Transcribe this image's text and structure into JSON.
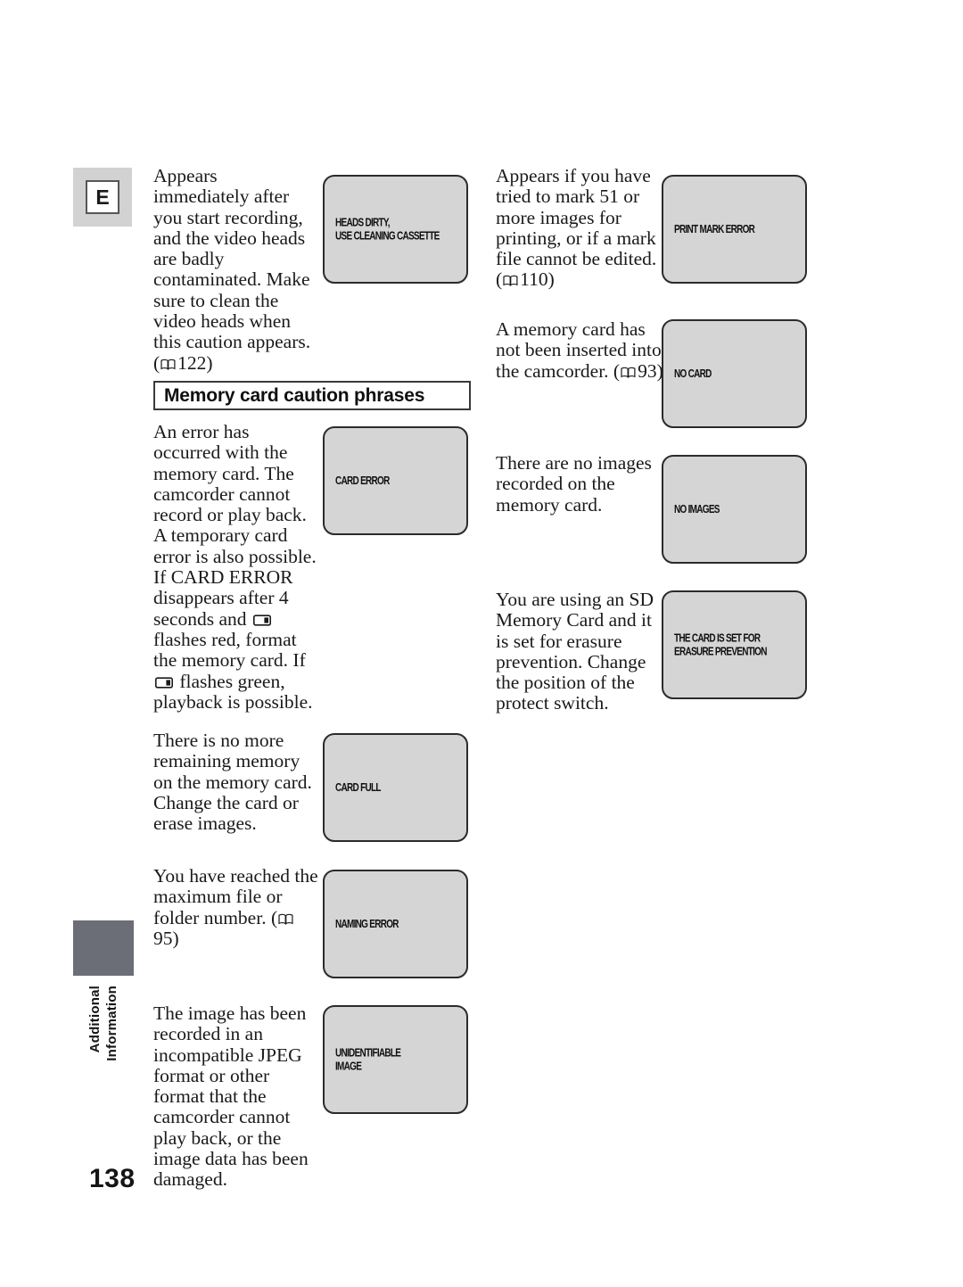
{
  "page": {
    "number": "138",
    "language_badge": "E",
    "side_tab_line1": "Additional",
    "side_tab_line2": "Information",
    "accent_gray": "#6b6e77",
    "lcd_fill": "#d5d5d5"
  },
  "section_heading": "Memory card caution phrases",
  "left_column": [
    {
      "description_pre": "Appears immediately after you start recording, and the video heads are badly contaminated. Make sure to clean the video heads when this caution appears. (",
      "page_ref": "122",
      "description_post": ")",
      "lcd_text": "HEADS DIRTY,\nUSE CLEANING CASSETTE"
    },
    {
      "description_pre": "An error has occurred with the memory card. The camcorder cannot record or play back. A temporary card error is also possible. If CARD ERROR disappears after 4 seconds and ",
      "description_mid": " flashes red, format the memory card. If ",
      "description_post": " flashes green, playback is possible.",
      "lcd_text": "CARD ERROR"
    },
    {
      "description_pre": "There is no more remaining memory on the memory card. Change the card or erase images.",
      "lcd_text": "CARD FULL"
    },
    {
      "description_pre": "You have reached the maximum file or folder number. (",
      "page_ref": "95",
      "description_post": ")",
      "lcd_text": "NAMING ERROR"
    },
    {
      "description_pre": "The image has been recorded in an incompatible JPEG format or other format that the camcorder cannot play back, or the image data has been damaged.",
      "lcd_text": "UNIDENTIFIABLE\n IMAGE"
    }
  ],
  "right_column": [
    {
      "description_pre": "Appears if you have tried to mark 51 or more images for printing, or if a mark file cannot be edited. (",
      "page_ref": "110",
      "description_post": ")",
      "lcd_text": "PRINT MARK ERROR"
    },
    {
      "description_pre": "A memory card has not been inserted into the camcorder. (",
      "page_ref": "93",
      "description_post": ")",
      "lcd_text": "NO CARD"
    },
    {
      "description_pre": "There are no images recorded on the memory card.",
      "lcd_text": "NO IMAGES"
    },
    {
      "description_pre": "You are using an SD Memory Card and it is set for erasure prevention. Change the position of the protect switch.",
      "lcd_text": "THE CARD IS SET FOR\nERASURE PREVENTION"
    }
  ]
}
